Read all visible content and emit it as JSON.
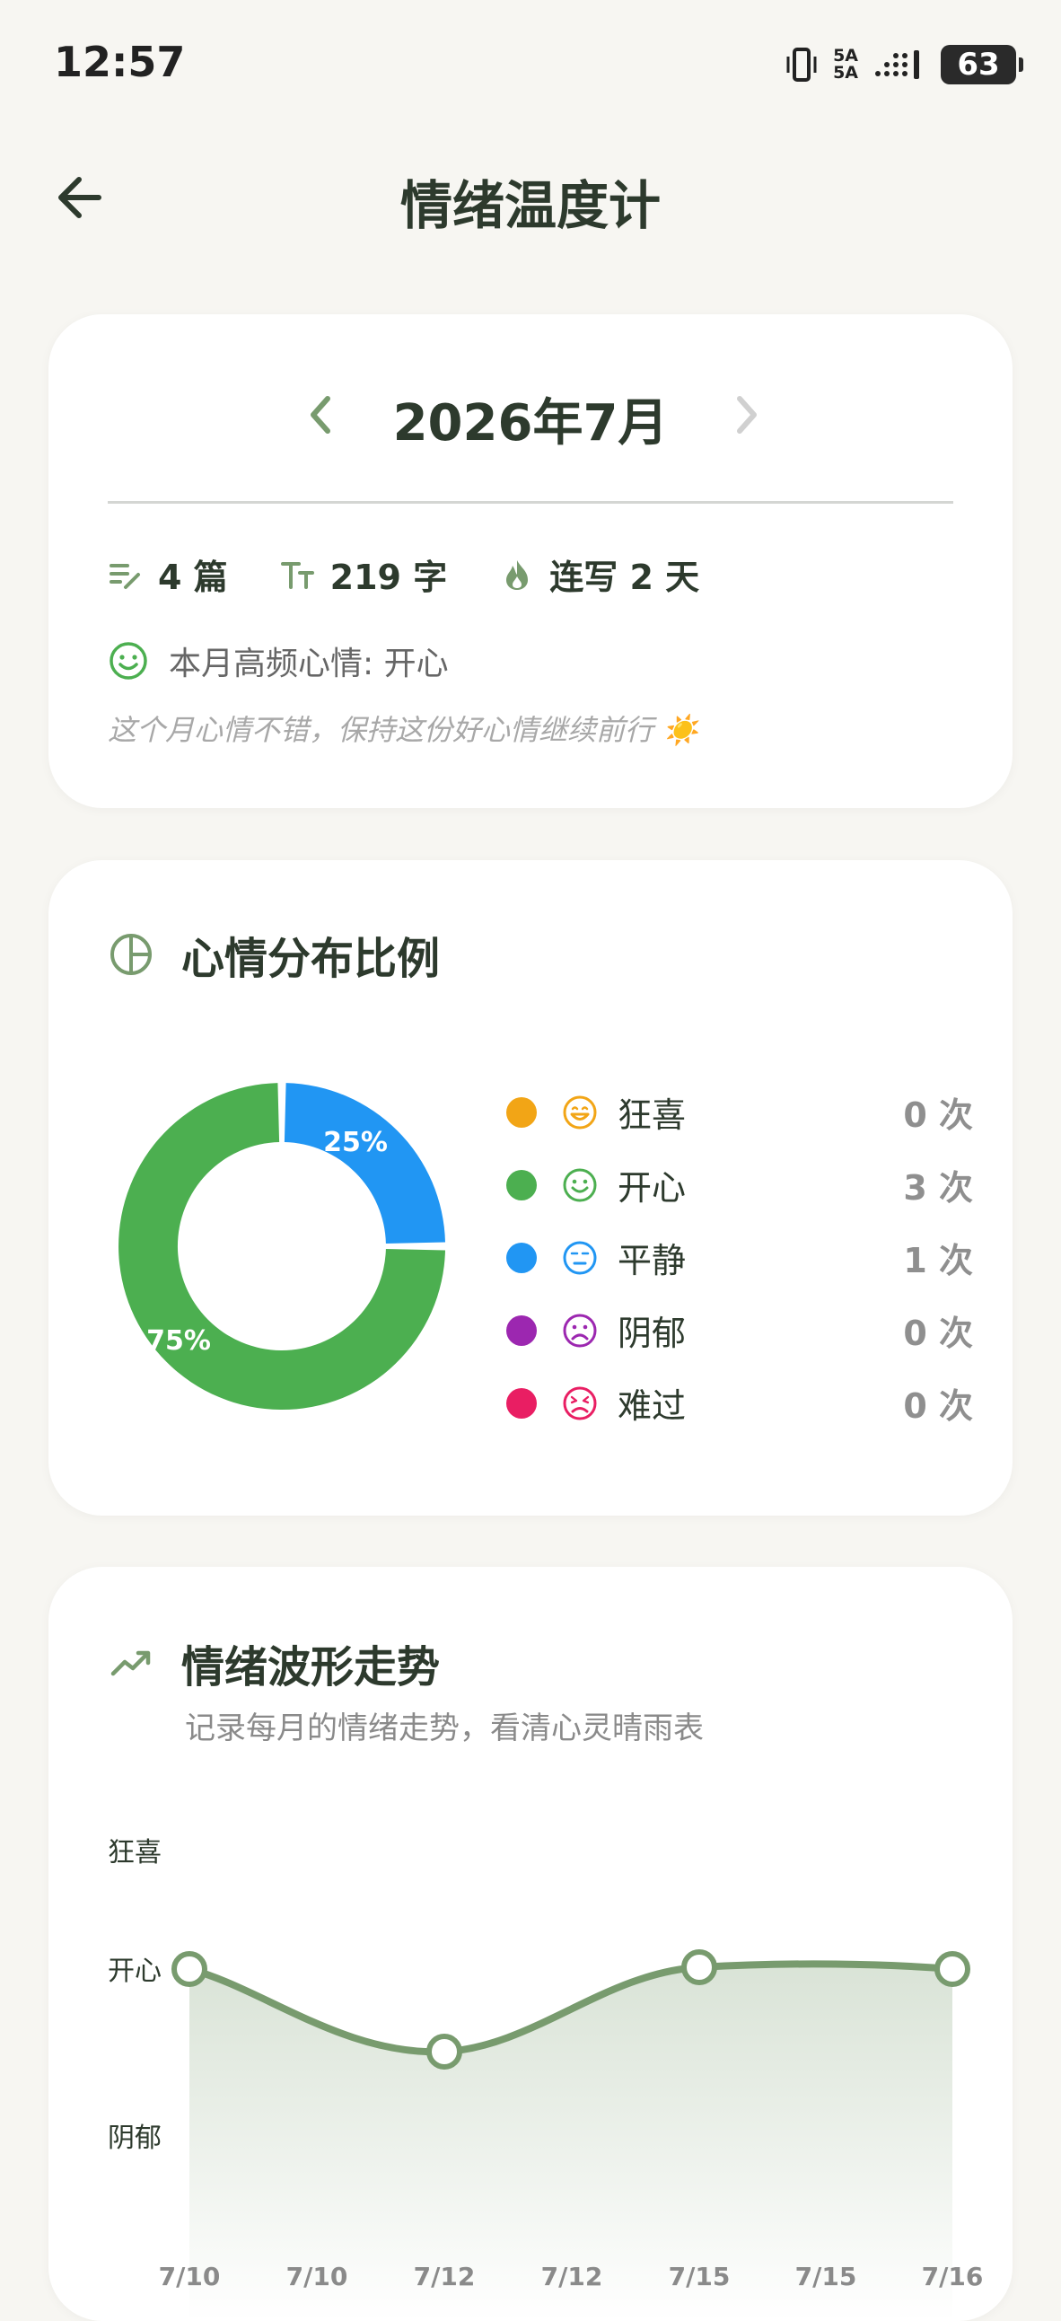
{
  "status": {
    "time": "12:57",
    "battery": "63",
    "signal1": "5A",
    "signal2": "5A"
  },
  "header": {
    "title": "情绪温度计"
  },
  "summary": {
    "month": "2026年7月",
    "entries_count": "4 篇",
    "words": "219 字",
    "streak": "连写 2 天",
    "top_mood": "本月高频心情: 开心",
    "message": "这个月心情不错，保持这份好心情继续前行 ☀️"
  },
  "distribution": {
    "title": "心情分布比例",
    "legend": [
      {
        "name": "狂喜",
        "count": "0 次",
        "color": "#f2a516"
      },
      {
        "name": "开心",
        "count": "3 次",
        "color": "#4caf50"
      },
      {
        "name": "平静",
        "count": "1 次",
        "color": "#2196f3"
      },
      {
        "name": "阴郁",
        "count": "0 次",
        "color": "#9c27b0"
      },
      {
        "name": "难过",
        "count": "0 次",
        "color": "#e91e63"
      }
    ]
  },
  "trend": {
    "title": "情绪波形走势",
    "subtitle": "记录每月的情绪走势，看清心灵晴雨表"
  },
  "chart_data": [
    {
      "type": "pie",
      "categories": [
        "开心",
        "平静"
      ],
      "values": [
        75,
        25
      ],
      "labels": [
        "75%",
        "25%"
      ],
      "colors": [
        "#4caf50",
        "#2196f3"
      ]
    },
    {
      "type": "area",
      "x": [
        "7/10",
        "7/10",
        "7/12",
        "7/12",
        "7/15",
        "7/15",
        "7/16"
      ],
      "y_ticks": [
        "狂喜",
        "开心",
        "阴郁"
      ],
      "points": [
        {
          "x": "7/10",
          "mood": "开心"
        },
        {
          "x": "7/12",
          "mood": "开心-平静之间"
        },
        {
          "x": "7/15",
          "mood": "开心"
        },
        {
          "x": "7/16",
          "mood": "开心"
        }
      ],
      "line_color": "#789b6e"
    }
  ]
}
